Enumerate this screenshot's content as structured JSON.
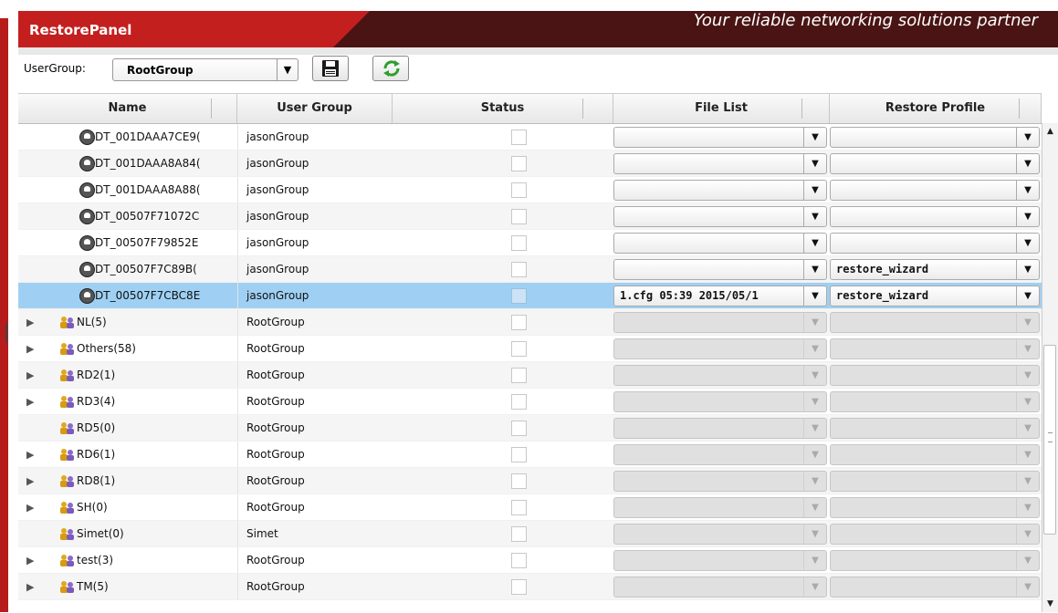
{
  "header": {
    "panel_title": "RestorePanel",
    "tagline": "Your reliable networking solutions partner",
    "colors": {
      "accent": "#c41f1f",
      "dark": "#4a1414",
      "selection": "#9fd0f3"
    }
  },
  "toolbar": {
    "usergroup_label": "UserGroup:",
    "usergroup_value": "RootGroup",
    "save_icon": "floppy-save-icon",
    "refresh_icon": "refresh-icon"
  },
  "columns": [
    "Name",
    "User Group",
    "Status",
    "File List",
    "Restore Profile"
  ],
  "rows": [
    {
      "type": "device",
      "name": "DT_001DAAA7CE9(",
      "group": "jasonGroup",
      "file_list": "",
      "restore_profile": "",
      "disabled": false
    },
    {
      "type": "device",
      "name": "DT_001DAAA8A84(",
      "group": "jasonGroup",
      "file_list": "",
      "restore_profile": "",
      "disabled": false
    },
    {
      "type": "device",
      "name": "DT_001DAAA8A88(",
      "group": "jasonGroup",
      "file_list": "",
      "restore_profile": "",
      "disabled": false
    },
    {
      "type": "device",
      "name": "DT_00507F71072C",
      "group": "jasonGroup",
      "file_list": "",
      "restore_profile": "",
      "disabled": false
    },
    {
      "type": "device",
      "name": "DT_00507F79852E",
      "group": "jasonGroup",
      "file_list": "",
      "restore_profile": "",
      "disabled": false
    },
    {
      "type": "device",
      "name": "DT_00507F7C89B(",
      "group": "jasonGroup",
      "file_list": "",
      "restore_profile": "restore_wizard",
      "disabled": false
    },
    {
      "type": "device",
      "name": "DT_00507F7CBC8E",
      "group": "jasonGroup",
      "file_list": "1.cfg 05:39 2015/05/1",
      "restore_profile": "restore_wizard",
      "disabled": false,
      "selected": true
    },
    {
      "type": "group",
      "expandable": true,
      "name": "NL(5)",
      "group": "RootGroup",
      "disabled": true
    },
    {
      "type": "group",
      "expandable": true,
      "name": "Others(58)",
      "group": "RootGroup",
      "disabled": true
    },
    {
      "type": "group",
      "expandable": true,
      "name": "RD2(1)",
      "group": "RootGroup",
      "disabled": true
    },
    {
      "type": "group",
      "expandable": true,
      "name": "RD3(4)",
      "group": "RootGroup",
      "disabled": true
    },
    {
      "type": "group",
      "expandable": false,
      "name": "RD5(0)",
      "group": "RootGroup",
      "disabled": true
    },
    {
      "type": "group",
      "expandable": true,
      "name": "RD6(1)",
      "group": "RootGroup",
      "disabled": true
    },
    {
      "type": "group",
      "expandable": true,
      "name": "RD8(1)",
      "group": "RootGroup",
      "disabled": true
    },
    {
      "type": "group",
      "expandable": true,
      "name": "SH(0)",
      "group": "RootGroup",
      "disabled": true
    },
    {
      "type": "group",
      "expandable": false,
      "name": "Simet(0)",
      "group": "Simet",
      "disabled": true
    },
    {
      "type": "group",
      "expandable": true,
      "name": "test(3)",
      "group": "RootGroup",
      "disabled": true
    },
    {
      "type": "group",
      "expandable": true,
      "name": "TM(5)",
      "group": "RootGroup",
      "disabled": true
    }
  ]
}
